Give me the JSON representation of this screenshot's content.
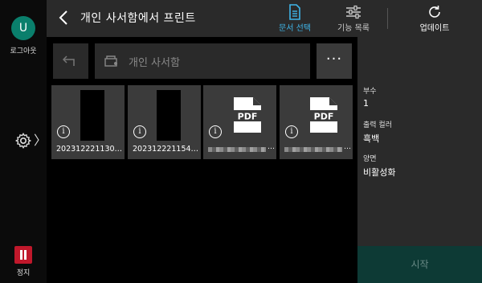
{
  "rail": {
    "avatar_letter": "U",
    "logout_label": "로그아웃",
    "settings_chevron": "〉",
    "stop_label": "정지"
  },
  "topbar": {
    "title": "개인 사서함에서 프린트",
    "select_docs_label": "문서 선택",
    "function_list_label": "기능 목록",
    "update_label": "업데이트"
  },
  "toolbar": {
    "up_icon": "up-arrow-icon",
    "path_placeholder": "개인 사서함",
    "more_label": "···"
  },
  "files": [
    {
      "type": "image",
      "name": "202312221130…"
    },
    {
      "type": "image",
      "name": "202312221154…"
    },
    {
      "type": "pdf",
      "name": "",
      "pdf_label": "PDF"
    },
    {
      "type": "pdf",
      "name": "",
      "pdf_label": "PDF"
    }
  ],
  "settings": {
    "copies_label": "부수",
    "copies_value": "1",
    "color_label": "출력 컬러",
    "color_value": "흑백",
    "duplex_label": "양면",
    "duplex_value": "비활성화"
  },
  "start_label": "시작",
  "colors": {
    "accent": "#3fb5e8",
    "avatar": "#0a7f6c",
    "stop": "#c0182b",
    "start_bg": "#0d3a35"
  }
}
